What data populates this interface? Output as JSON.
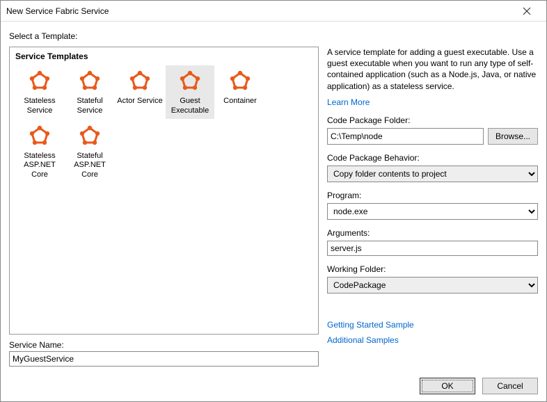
{
  "window": {
    "title": "New Service Fabric Service"
  },
  "instruction": "Select a Template:",
  "templates": {
    "heading": "Service Templates",
    "items": [
      {
        "label": "Stateless Service",
        "selected": false
      },
      {
        "label": "Stateful Service",
        "selected": false
      },
      {
        "label": "Actor Service",
        "selected": false
      },
      {
        "label": "Guest Executable",
        "selected": true
      },
      {
        "label": "Container",
        "selected": false
      },
      {
        "label": "Stateless ASP.NET Core",
        "selected": false
      },
      {
        "label": "Stateful ASP.NET Core",
        "selected": false
      }
    ]
  },
  "details": {
    "description": "A service template for adding a guest executable. Use a guest executable when you want to run any type of self-contained application (such as a Node.js, Java, or native application) as a stateless service.",
    "learn_more": "Learn More",
    "code_folder_label": "Code Package Folder:",
    "code_folder_value": "C:\\Temp\\node",
    "browse_label": "Browse...",
    "behavior_label": "Code Package Behavior:",
    "behavior_value": "Copy folder contents to project",
    "program_label": "Program:",
    "program_value": "node.exe",
    "arguments_label": "Arguments:",
    "arguments_value": "server.js",
    "working_folder_label": "Working Folder:",
    "working_folder_value": "CodePackage",
    "getting_started": "Getting Started Sample",
    "additional_samples": "Additional Samples"
  },
  "service_name": {
    "label": "Service Name:",
    "value": "MyGuestService"
  },
  "buttons": {
    "ok": "OK",
    "cancel": "Cancel"
  }
}
